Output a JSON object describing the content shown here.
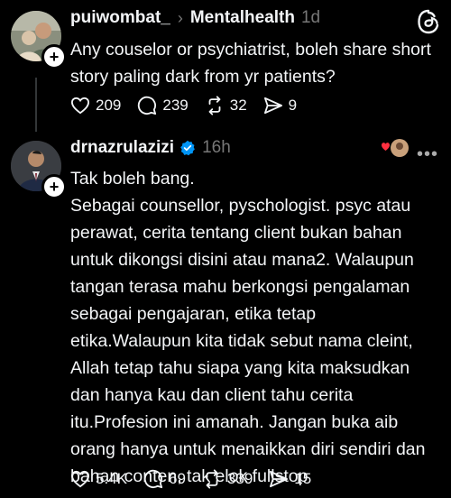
{
  "post1": {
    "username": "puiwombat_",
    "chevron": "›",
    "topic": "Mentalhealth",
    "time": "1d",
    "text": "Any couselor or psychiatrist, boleh share short story paling dark from yr patients?",
    "actions": {
      "likes": "209",
      "comments": "239",
      "reposts": "32",
      "shares": "9"
    }
  },
  "post2": {
    "username": "drnazrulazizi",
    "time": "16h",
    "text": "Tak boleh bang.\nSebagai counsellor, pyschologist. psyc atau perawat, cerita tentang client bukan bahan untuk dikongsi disini atau mana2. Walaupun tangan terasa mahu berkongsi pengalaman sebagai pengajaran, etika tetap etika.Walaupun kita tidak sebut nama cleint, Allah tetap tahu siapa yang kita maksudkan dan hanya kau dan client tahu cerita itu.Profesion ini amanah. Jangan buka aib orang hanya untuk menaikkan diri sendiri dan bahan conten, tak elok fullstop",
    "actions": {
      "likes": "5.4K",
      "comments": "69",
      "reposts": "339",
      "shares": "15"
    }
  },
  "icons": {
    "threads": "threads-logo-icon",
    "heart": "heart-icon",
    "comment": "comment-icon",
    "repost": "repost-icon",
    "share": "share-icon",
    "verified": "verified-badge-icon",
    "more": "more-options-icon",
    "plus": "follow-plus-icon"
  },
  "colors": {
    "background": "#000000",
    "text": "#f3f5f7",
    "muted": "#777777",
    "verified": "#0095f6",
    "heart": "#ff3040"
  },
  "more_label": "•••",
  "plus_label": "+"
}
